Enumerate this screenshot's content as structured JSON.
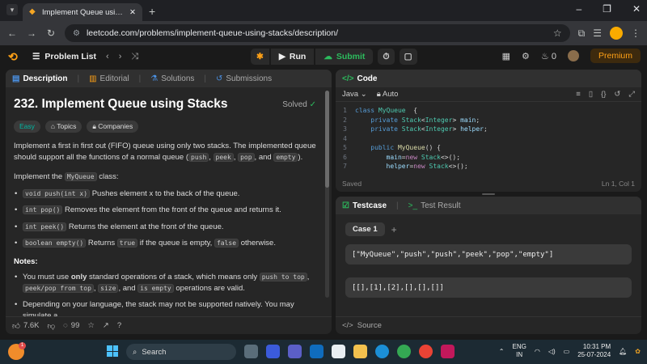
{
  "browser": {
    "tab_title": "Implement Queue using Stacks",
    "url_host": "leetcode.com/problems/implement-queue-using-stacks/description/"
  },
  "nav": {
    "problem_list": "Problem List",
    "run": "Run",
    "submit": "Submit",
    "coins": "0",
    "premium": "Premium"
  },
  "desc_tabs": [
    "Description",
    "Editorial",
    "Solutions",
    "Submissions"
  ],
  "problem": {
    "title": "232. Implement Queue using Stacks",
    "status": "Solved",
    "difficulty": "Easy",
    "topics": "Topics",
    "companies": "Companies",
    "intro_1": "Implement a first in first out (FIFO) queue using only two stacks. The implemented queue should support all the functions of a normal queue (",
    "intro_c1": "push",
    "intro_c2": "peek",
    "intro_c3": "pop",
    "intro_and": ", and",
    "intro_c4": "empty",
    "intro_end": ").",
    "impl_pre": "Implement the",
    "impl_code": "MyQueue",
    "impl_post": "class:",
    "methods": [
      {
        "code": "void push(int x)",
        "text": "Pushes element x to the back of the queue."
      },
      {
        "code": "int pop()",
        "text": "Removes the element from the front of the queue and returns it."
      },
      {
        "code": "int peek()",
        "text": "Returns the element at the front of the queue."
      }
    ],
    "m4_code": "boolean empty()",
    "m4_text1": "Returns",
    "m4_true": "true",
    "m4_text2": "if the queue is empty,",
    "m4_false": "false",
    "m4_text3": "otherwise.",
    "notes_label": "Notes:",
    "note1_pre": "You must use",
    "note1_bold": "only",
    "note1_mid": "standard operations of a stack, which means only",
    "note1_c1": "push to top",
    "note1_c2": "peek/pop from top",
    "note1_c3": "size",
    "note1_and": ", and",
    "note1_c4": "is empty",
    "note1_end": "operations are valid.",
    "note2": "Depending on your language, the stack may not be supported natively. You may simulate a"
  },
  "desc_footer": {
    "likes": "7.6K",
    "comments": "99"
  },
  "code_panel": {
    "title": "Code",
    "language": "Java",
    "auto": "Auto",
    "saved": "Saved",
    "cursor": "Ln 1, Col 1",
    "lines": [
      {
        "n": "1",
        "parts": [
          [
            "kw2",
            "class "
          ],
          [
            "cls",
            "MyQueue"
          ],
          [
            "",
            "  {"
          ]
        ]
      },
      {
        "n": "2",
        "parts": [
          [
            "",
            "    "
          ],
          [
            "kw2",
            "private "
          ],
          [
            "cls",
            "Stack"
          ],
          [
            "",
            "<"
          ],
          [
            "cls",
            "Integer"
          ],
          [
            "",
            "> "
          ],
          [
            "var",
            "main"
          ],
          [
            "",
            ";"
          ]
        ]
      },
      {
        "n": "3",
        "parts": [
          [
            "",
            "    "
          ],
          [
            "kw2",
            "private "
          ],
          [
            "cls",
            "Stack"
          ],
          [
            "",
            "<"
          ],
          [
            "cls",
            "Integer"
          ],
          [
            "",
            "> "
          ],
          [
            "var",
            "helper"
          ],
          [
            "",
            ";"
          ]
        ]
      },
      {
        "n": "4",
        "parts": [
          [
            "",
            ""
          ]
        ]
      },
      {
        "n": "5",
        "parts": [
          [
            "",
            "    "
          ],
          [
            "kw2",
            "public "
          ],
          [
            "fn",
            "MyQueue"
          ],
          [
            "",
            "() {"
          ]
        ]
      },
      {
        "n": "6",
        "parts": [
          [
            "",
            "        "
          ],
          [
            "var",
            "main"
          ],
          [
            "",
            "="
          ],
          [
            "kw",
            "new "
          ],
          [
            "cls",
            "Stack"
          ],
          [
            "",
            "<>();"
          ]
        ]
      },
      {
        "n": "7",
        "parts": [
          [
            "",
            "        "
          ],
          [
            "var",
            "helper"
          ],
          [
            "",
            "="
          ],
          [
            "kw",
            "new "
          ],
          [
            "cls",
            "Stack"
          ],
          [
            "",
            "<>();"
          ]
        ]
      }
    ]
  },
  "test_panel": {
    "tab1": "Testcase",
    "tab2": "Test Result",
    "case": "Case 1",
    "input1": "[\"MyQueue\",\"push\",\"push\",\"peek\",\"pop\",\"empty\"]",
    "input2": "[[],[1],[2],[],[],[]]",
    "source": "Source"
  },
  "taskbar": {
    "weather_badge": "1",
    "search": "Search",
    "lang1": "ENG",
    "lang2": "IN",
    "time": "10:31 PM",
    "date": "25-07-2024"
  },
  "colors": {
    "accent": "#ffa116",
    "submit": "#2cbb5d",
    "easy": "#00b8a3"
  }
}
